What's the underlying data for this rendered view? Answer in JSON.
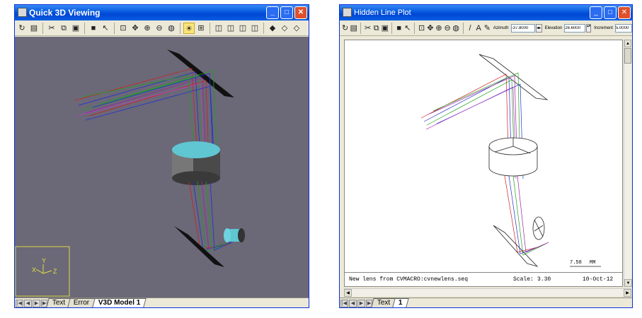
{
  "left_window": {
    "title": "Quick 3D Viewing",
    "tabs": [
      "Text",
      "Error",
      "V3D Model 1"
    ],
    "active_tab": "V3D Model 1",
    "axis_labels": {
      "y": "Y",
      "x": "X",
      "z": "Z"
    },
    "colors": {
      "viewport": "#6b6878",
      "lens": "#5fc6d2"
    }
  },
  "right_window": {
    "title": "Hidden Line Plot",
    "azimuth_label": "Azimuth",
    "azimuth_value": "-37.8000",
    "elevation_label": "Elevation",
    "elevation_value": "26.6000",
    "increment_label": "Increment",
    "increment_value": "5.0000",
    "footer_text": "New lens from CVMACRO:cvnewlens.seq",
    "scale_label": "Scale:",
    "scale_value": "3.30",
    "date": "10-Oct-12",
    "scalebar_value": "7.58",
    "scalebar_unit": "MM",
    "tabs": [
      "Text",
      "1"
    ],
    "active_tab": "1"
  }
}
